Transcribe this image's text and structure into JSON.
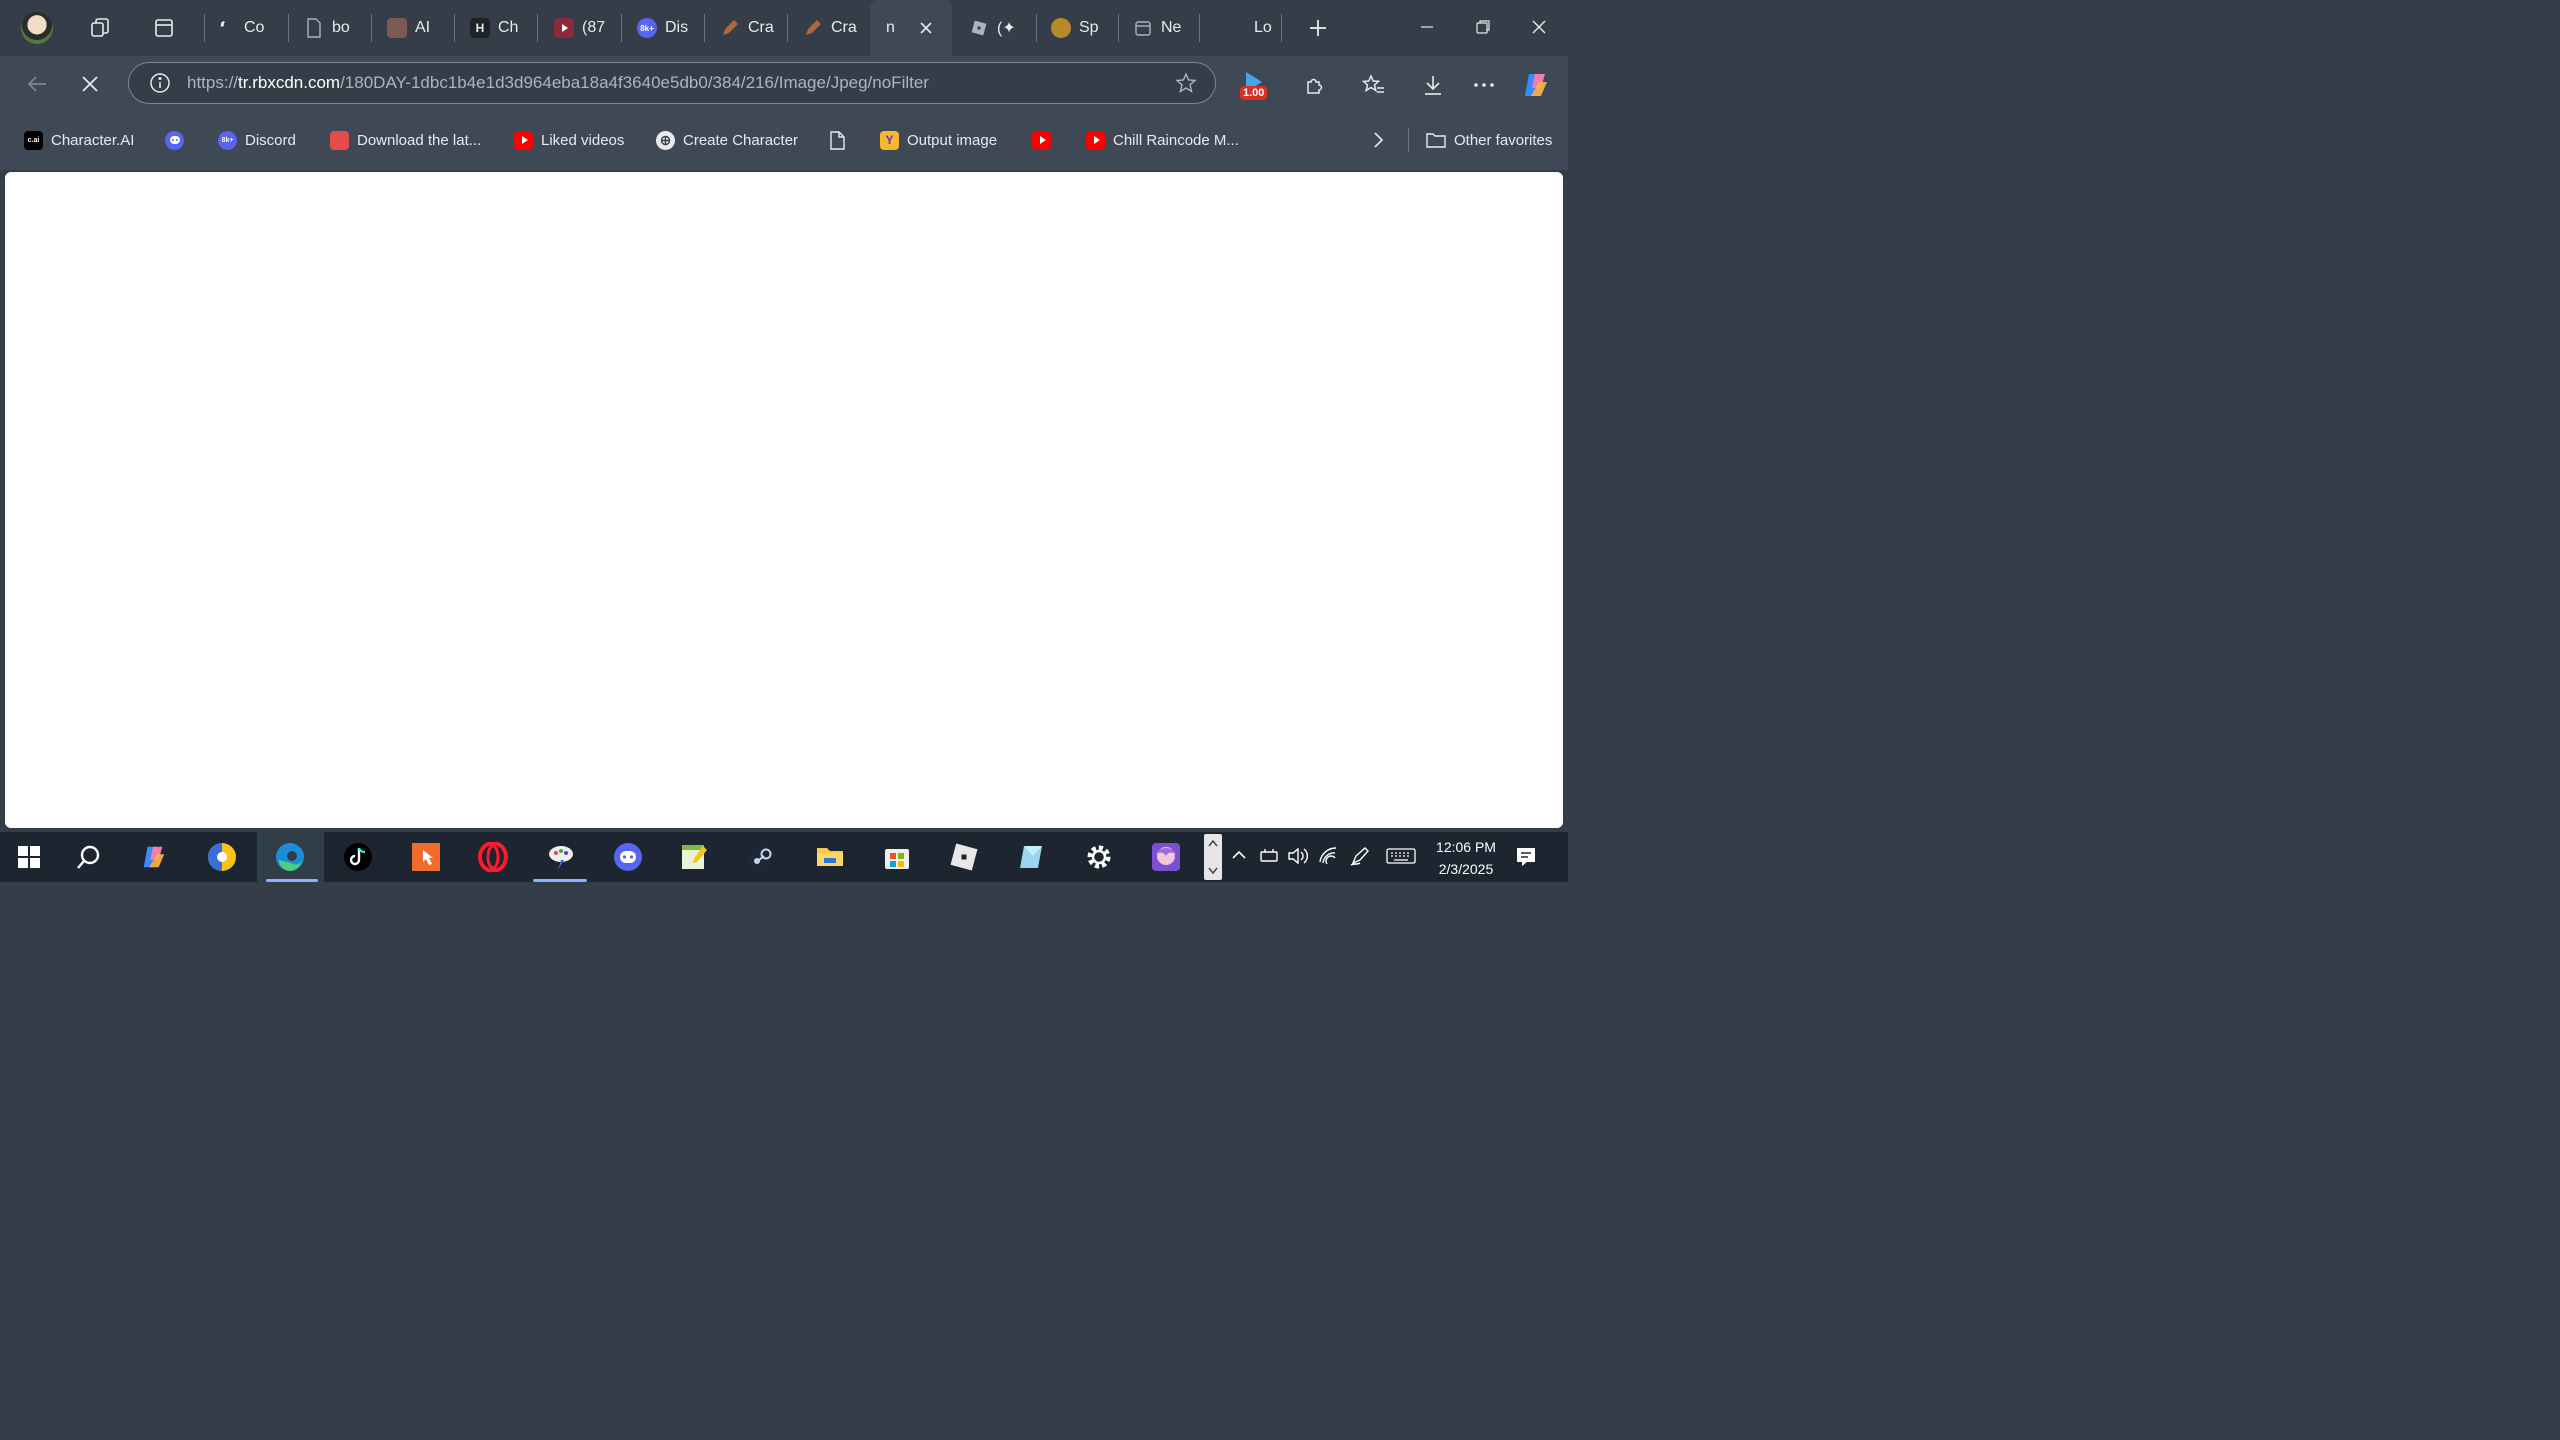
{
  "tabs": [
    {
      "title": "Co",
      "icon": "phone-icon"
    },
    {
      "title": "bo",
      "icon": "document-icon"
    },
    {
      "title": "AI",
      "icon": "ai-avatar-icon"
    },
    {
      "title": "Ch",
      "icon": "h-logo-icon"
    },
    {
      "title": "(87",
      "icon": "youtube-icon"
    },
    {
      "title": "Dis",
      "icon": "discord-8k-icon",
      "badge": "8k+"
    },
    {
      "title": "Cra",
      "icon": "pencil-icon"
    },
    {
      "title": "Cra",
      "icon": "pencil-icon"
    },
    {
      "title": "n",
      "icon": "none",
      "active": true
    },
    {
      "title": "(✦",
      "icon": "roblox-icon"
    },
    {
      "title": "Sp",
      "icon": "bear-icon"
    },
    {
      "title": "Ne",
      "icon": "calendar-icon"
    },
    {
      "title": "Lo",
      "icon": "none"
    }
  ],
  "address": {
    "url_prefix": "https://",
    "url_host": "tr.rbxcdn.com",
    "url_path": "/180DAY-1dbc1b4e1d3d964eba18a4f3640e5db0/384/216/Image/Jpeg/noFilter"
  },
  "extension_badge": "1.00",
  "favorites": [
    {
      "label": "Character.AI",
      "icon": "character-ai-icon",
      "icon_text": "c.ai"
    },
    {
      "label": "",
      "icon": "discord-icon"
    },
    {
      "label": "Discord",
      "icon": "discord-8k-icon",
      "icon_text": "8k+"
    },
    {
      "label": "Download the lat...",
      "icon": "store-icon"
    },
    {
      "label": "Liked videos",
      "icon": "youtube-icon"
    },
    {
      "label": "Create Character",
      "icon": "openai-icon"
    },
    {
      "label": "",
      "icon": "document-icon"
    },
    {
      "label": "Output image",
      "icon": "y-logo-icon",
      "icon_text": "Y"
    },
    {
      "label": "",
      "icon": "youtube-icon"
    },
    {
      "label": "Chill Raincode M...",
      "icon": "youtube-icon"
    }
  ],
  "other_favorites": "Other favorites",
  "taskbar": {
    "apps": [
      "start-icon",
      "search-icon",
      "copilot-icon",
      "chrome-dev-icon",
      "edge-icon",
      "tiktok-icon",
      "clicker-app-icon",
      "opera-icon",
      "paint-app-icon",
      "discord-icon",
      "notepad-app-icon",
      "steam-icon",
      "file-explorer-icon",
      "microsoft-store-icon",
      "roblox-icon",
      "roblox-studio-icon",
      "settings-icon",
      "anime-app-icon"
    ],
    "time": "12:06 PM",
    "date": "2/3/2025"
  },
  "colors": {
    "accent": "#8ab4f8",
    "frame": "#353d48",
    "toolbar": "#3f4955"
  }
}
